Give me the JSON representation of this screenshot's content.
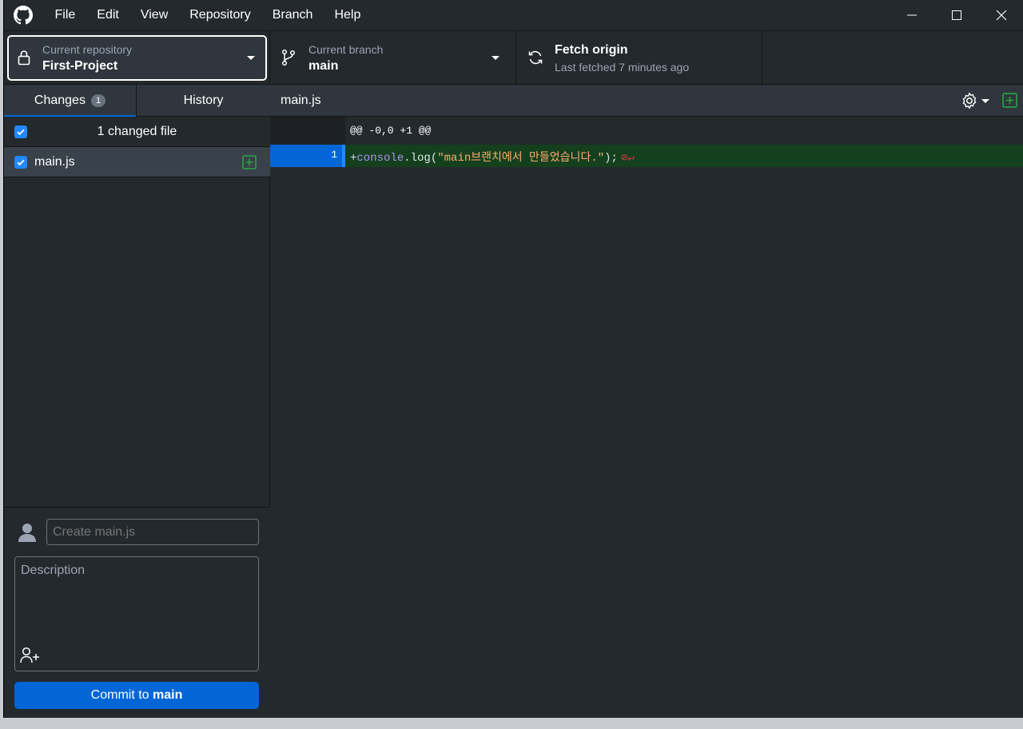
{
  "menu": [
    "File",
    "Edit",
    "View",
    "Repository",
    "Branch",
    "Help"
  ],
  "toolbar": {
    "repo_label": "Current repository",
    "repo_value": "First-Project",
    "branch_label": "Current branch",
    "branch_value": "main",
    "fetch_title": "Fetch origin",
    "fetch_subtitle": "Last fetched 7 minutes ago"
  },
  "sidebar": {
    "tab_changes": "Changes",
    "tab_changes_count": "1",
    "tab_history": "History",
    "changed_files_header": "1 changed file",
    "files": [
      {
        "name": "main.js",
        "checked": true,
        "status": "added"
      }
    ]
  },
  "commit": {
    "summary_placeholder": "Create main.js",
    "description_placeholder": "Description",
    "button_prefix": "Commit to ",
    "button_branch": "main"
  },
  "diff": {
    "file_name": "main.js",
    "hunk_header": "@@ -0,0 +1 @@",
    "line_number": "1",
    "line_plus": "+",
    "line_obj": "console",
    "line_call": ".log(",
    "line_str": "\"main브랜치에서 만들었습니다.\"",
    "line_end": ");",
    "no_newline_marker": "⊘↵"
  },
  "colors": {
    "accent": "#0366d6",
    "added_bg": "#14401e",
    "added_icon": "#28a745",
    "string": "#ffab70",
    "keyword": "#b392f0"
  }
}
